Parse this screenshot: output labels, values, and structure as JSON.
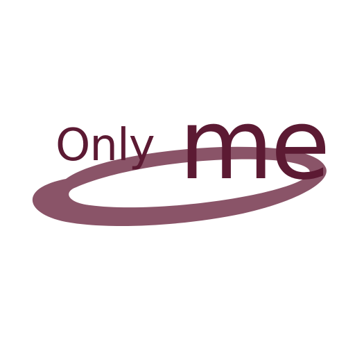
{
  "logo": {
    "word_primary": "Only",
    "word_secondary": "me",
    "text_color": "#5c1a33",
    "swoosh_color": "#8a5468",
    "background_color": "#ffffff"
  }
}
